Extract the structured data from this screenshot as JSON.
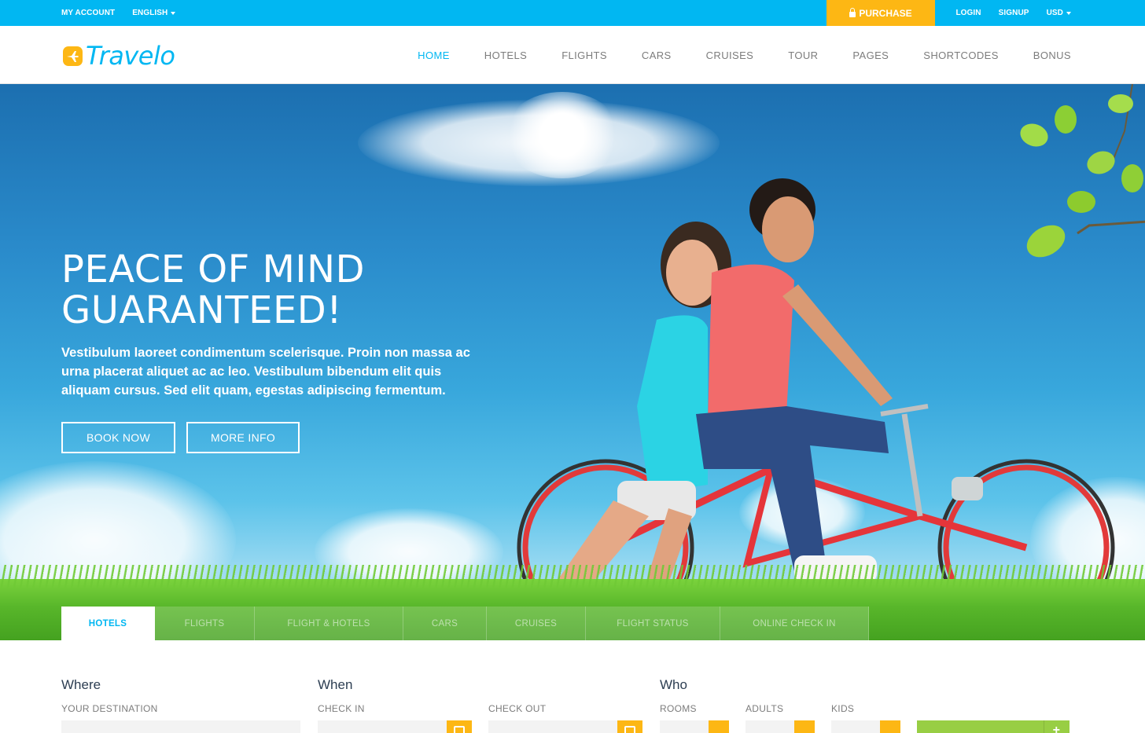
{
  "topbar": {
    "my_account": "MY ACCOUNT",
    "language": "ENGLISH",
    "purchase": "PURCHASE",
    "login": "LOGIN",
    "signup": "SIGNUP",
    "currency": "USD"
  },
  "header": {
    "logo_text": "Travelo",
    "nav": [
      "HOME",
      "HOTELS",
      "FLIGHTS",
      "CARS",
      "CRUISES",
      "TOUR",
      "PAGES",
      "SHORTCODES",
      "BONUS"
    ],
    "active_nav": "HOME"
  },
  "hero": {
    "title_line1": "PEACE OF MIND",
    "title_line2": "GUARANTEED!",
    "text": "Vestibulum laoreet condimentum scelerisque. Proin non massa ac urna placerat aliquet ac ac leo. Vestibulum bibendum elit quis aliquam cursus. Sed elit quam, egestas adipiscing fermentum.",
    "book_now": "BOOK NOW",
    "more_info": "MORE INFO"
  },
  "tabs": [
    "HOTELS",
    "FLIGHTS",
    "FLIGHT & HOTELS",
    "CARS",
    "CRUISES",
    "FLIGHT STATUS",
    "ONLINE CHECK IN"
  ],
  "search": {
    "where_title": "Where",
    "where_label": "YOUR DESTINATION",
    "when_title": "When",
    "check_in_label": "CHECK IN",
    "check_out_label": "CHECK OUT",
    "who_title": "Who",
    "rooms_label": "ROOMS",
    "adults_label": "ADULTS",
    "kids_label": "KIDS"
  },
  "colors": {
    "primary": "#01b7f2",
    "accent": "#fdb714",
    "go_button": "#98ce44",
    "heading": "#2d3e52"
  },
  "icons": [
    "lock-icon",
    "caret-down-icon",
    "plane-icon",
    "calendar-icon",
    "plus-icon"
  ]
}
